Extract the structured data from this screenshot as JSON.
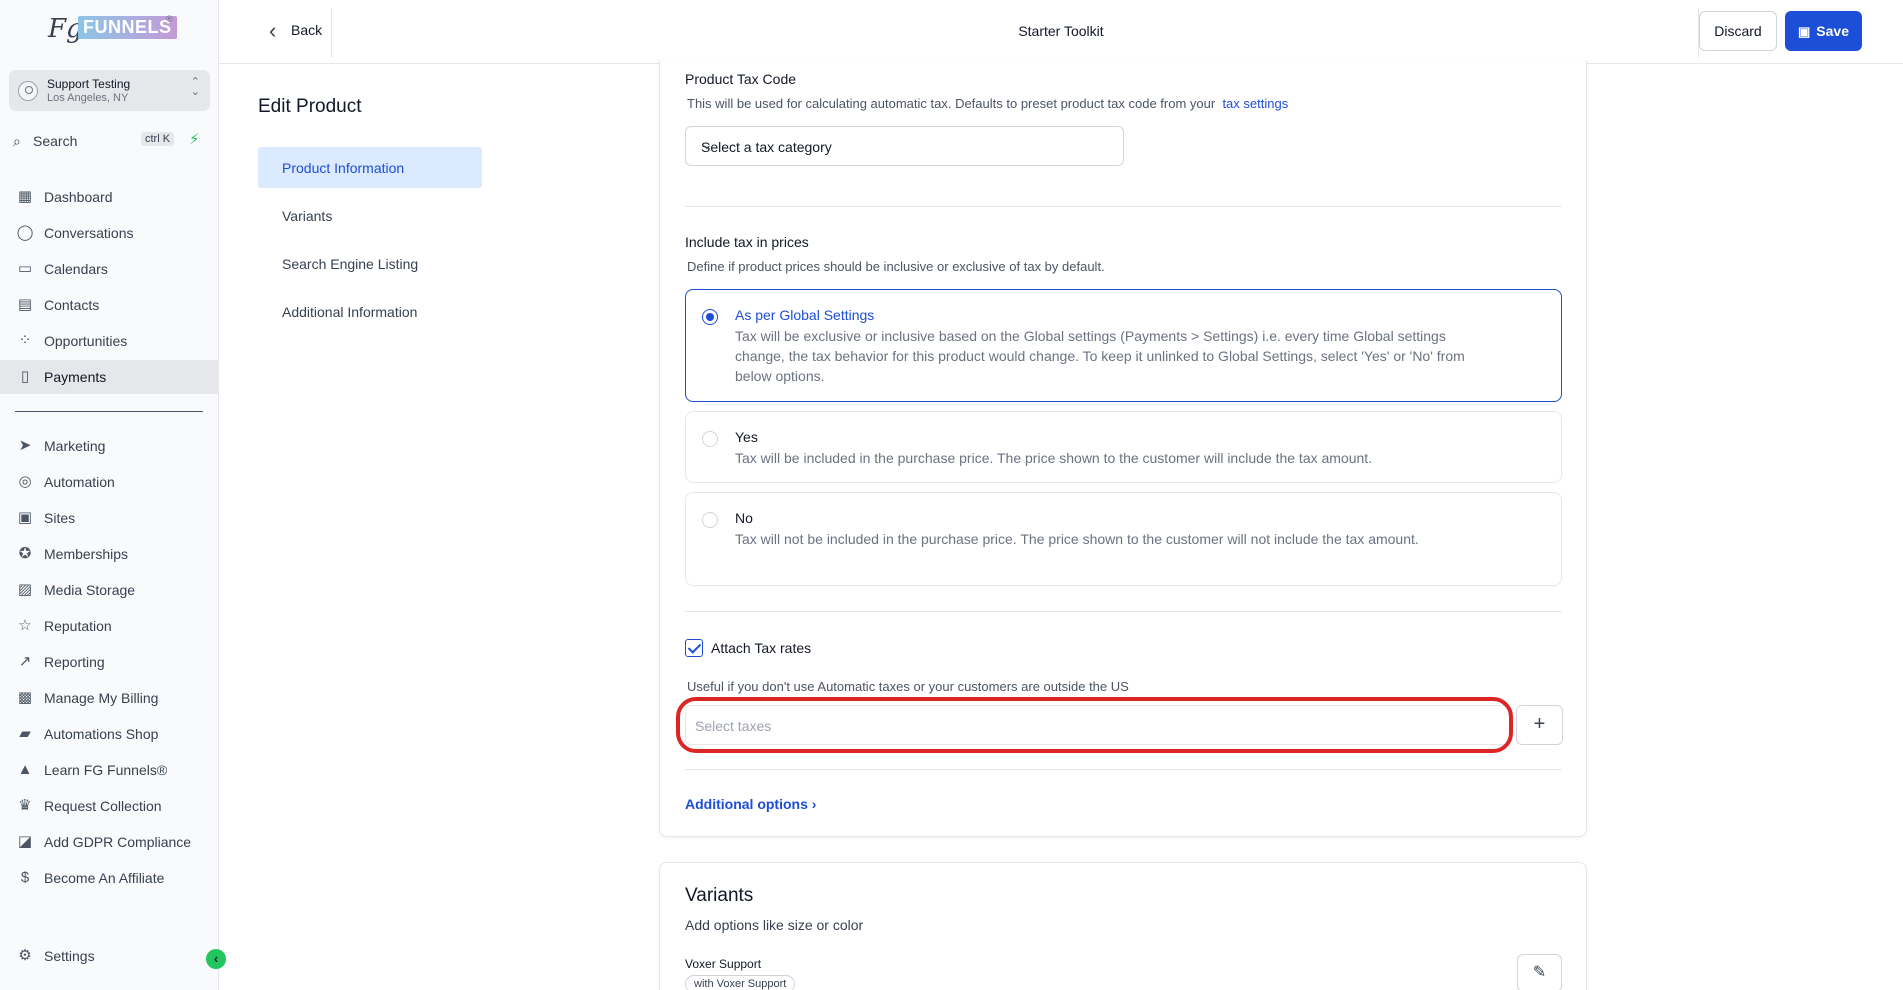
{
  "brand": {
    "logo_fg": "Fg",
    "logo_funnels": "FUNNELS",
    "logo_reg": "®"
  },
  "account": {
    "name": "Support Testing",
    "location": "Los Angeles, NY"
  },
  "search": {
    "label": "Search",
    "shortcut": "ctrl K"
  },
  "sidebar": {
    "items": [
      {
        "label": "Dashboard",
        "icon": "dashboard-icon"
      },
      {
        "label": "Conversations",
        "icon": "chat-icon"
      },
      {
        "label": "Calendars",
        "icon": "calendar-icon"
      },
      {
        "label": "Contacts",
        "icon": "contacts-icon"
      },
      {
        "label": "Opportunities",
        "icon": "opportunities-icon"
      },
      {
        "label": "Payments",
        "icon": "payments-icon"
      },
      {
        "label": "Marketing",
        "icon": "send-icon"
      },
      {
        "label": "Automation",
        "icon": "automation-icon"
      },
      {
        "label": "Sites",
        "icon": "sites-icon"
      },
      {
        "label": "Memberships",
        "icon": "badge-icon"
      },
      {
        "label": "Media Storage",
        "icon": "image-icon"
      },
      {
        "label": "Reputation",
        "icon": "star-icon"
      },
      {
        "label": "Reporting",
        "icon": "trend-icon"
      },
      {
        "label": "Manage My Billing",
        "icon": "money-icon"
      },
      {
        "label": "Automations Shop",
        "icon": "cart-icon"
      },
      {
        "label": "Learn FG Funnels®",
        "icon": "graduation-icon"
      },
      {
        "label": "Request Collection",
        "icon": "trophy-icon"
      },
      {
        "label": "Add GDPR Compliance",
        "icon": "doc-check-icon"
      },
      {
        "label": "Become An Affiliate",
        "icon": "dollar-icon"
      }
    ],
    "settings_label": "Settings"
  },
  "header": {
    "back_label": "Back",
    "title": "Starter Toolkit",
    "discard_label": "Discard",
    "save_label": "Save"
  },
  "edit": {
    "title": "Edit Product",
    "subnav": [
      "Product Information",
      "Variants",
      "Search Engine Listing",
      "Additional Information"
    ]
  },
  "tax": {
    "code_label": "Product Tax Code",
    "code_help": "This will be used for calculating automatic tax. Defaults to preset product tax code from your",
    "code_link": "tax settings",
    "code_select": "Select a tax category",
    "include_label": "Include tax in prices",
    "include_help": "Define if product prices should be inclusive or exclusive of tax by default.",
    "options": [
      {
        "title": "As per Global Settings",
        "desc": "Tax will be exclusive or inclusive based on the Global settings (Payments > Settings) i.e. every time Global settings change, the tax behavior for this product would change. To keep it unlinked to Global Settings, select 'Yes' or 'No' from below options."
      },
      {
        "title": "Yes",
        "desc": "Tax will be included in the purchase price. The price shown to the customer will include the tax amount."
      },
      {
        "title": "No",
        "desc": "Tax will not be included in the purchase price. The price shown to the customer will not include the tax amount."
      }
    ],
    "attach_label": "Attach Tax rates",
    "attach_help": "Useful if you don't use Automatic taxes or your customers are outside the US",
    "taxes_placeholder": "Select taxes",
    "plus": "+",
    "additional_options": "Additional options ›"
  },
  "variants": {
    "title": "Variants",
    "subtitle": "Add options like size or color",
    "variant_name": "Voxer Support",
    "chip": "with Voxer Support"
  },
  "colors": {
    "accent": "#1d4ed8",
    "highlight": "#dc2626",
    "bolt": "#22c55e"
  }
}
